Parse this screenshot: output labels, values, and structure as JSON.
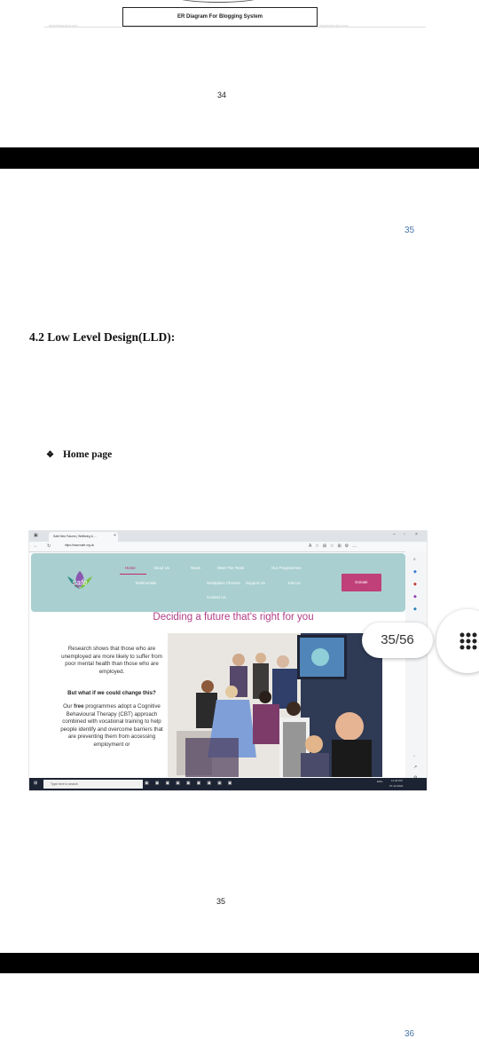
{
  "top_fragment": {
    "diagram_caption": "ER Diagram For Blogging System",
    "page_number": "34"
  },
  "page_35": {
    "header_page_number": "35",
    "heading": "4.2 Low Level Design(LLD):",
    "bullet": "Home page",
    "footer_page_number": "35"
  },
  "page_36": {
    "header_page_number": "36"
  },
  "screenshot": {
    "tab_title": "Safe New Futures | Wellbeing & ...",
    "url": "https://www.safe.org.uk",
    "site": {
      "logo_text": "safe",
      "nav_row1": [
        "Home",
        "About Us",
        "News",
        "Meet The Team",
        "Our Programmes"
      ],
      "nav_row2": [
        "Testimonials",
        "Workplace Choices",
        "Support Us",
        "Join Us"
      ],
      "nav_row3": [
        "Contact Us"
      ],
      "donate_label": "Donate",
      "hero_title": "Deciding a future that's right for you",
      "paragraph1": "Research shows that those who are unemployed are more likely to suffer from poor mental health than those who are employed.",
      "question": "But what if we could change this?",
      "paragraph2_prefix": "Our ",
      "paragraph2_bold": "free",
      "paragraph2_rest": " programmes adopt a Cognitive Behavioural Therapy (CBT) approach combined with vocational training to help people identify and overcome barriers that are preventing them from accessing employment or"
    },
    "taskbar": {
      "search_placeholder": "Type here to search",
      "time": "11:46 PM",
      "date": "07-12-2022",
      "lang": "ENG"
    }
  },
  "viewer": {
    "page_indicator": "35/56"
  },
  "colors": {
    "site_header": "#a9cfd0",
    "accent_magenta": "#c2266e",
    "donate": "#c0407a",
    "hero_title": "#b03c86",
    "page_number_blue": "#4a78a8"
  }
}
